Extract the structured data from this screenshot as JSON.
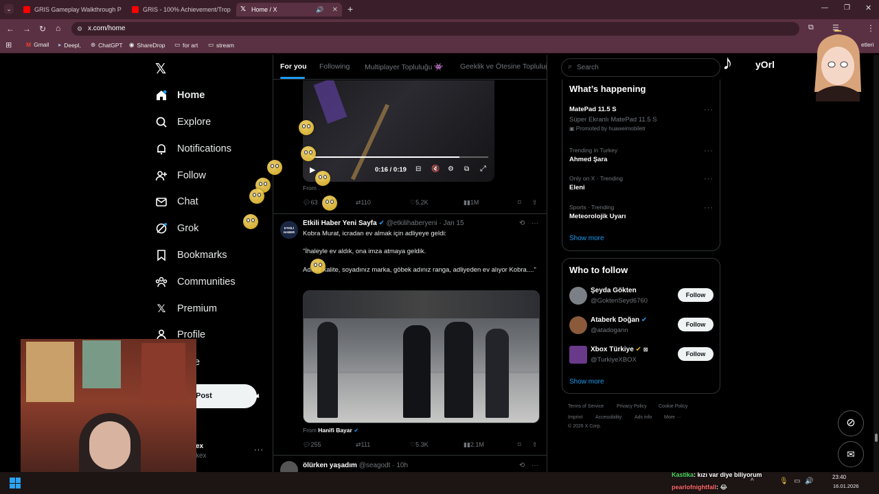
{
  "browser": {
    "tabs": [
      {
        "label": "GRIS Gameplay Walkthrough P"
      },
      {
        "label": "GRIS - 100% Achievement/Trop"
      },
      {
        "label": "Home / X"
      }
    ],
    "url": "x.com/home",
    "bookmarks": [
      "Gmail",
      "Deepl,",
      "ChatGPT",
      "ShareDrop",
      "for art",
      "stream"
    ],
    "bookmarks_overflow": "etleri"
  },
  "nav": {
    "items": [
      {
        "label": "Home",
        "icon": "home-icon"
      },
      {
        "label": "Explore",
        "icon": "search-icon"
      },
      {
        "label": "Notifications",
        "icon": "bell-icon"
      },
      {
        "label": "Follow",
        "icon": "person-add-icon"
      },
      {
        "label": "Chat",
        "icon": "mail-icon"
      },
      {
        "label": "Grok",
        "icon": "grok-icon"
      },
      {
        "label": "Bookmarks",
        "icon": "bookmark-icon"
      },
      {
        "label": "Communities",
        "icon": "communities-icon"
      },
      {
        "label": "Premium",
        "icon": "x-logo-icon"
      },
      {
        "label": "Profile",
        "icon": "person-icon"
      }
    ],
    "more_partial": "e",
    "post_label": "Post",
    "account_name_partial": "ex",
    "account_handle_partial": "kex"
  },
  "feed": {
    "tabs": [
      "For you",
      "Following",
      "Multiplayer Topluluğu 👾",
      "Geeklik ve Ötesine Topluluğ"
    ],
    "video": {
      "time": "0:16 / 0:19",
      "progress": 0.84
    },
    "video_tweet": {
      "from": "From .",
      "replies": "63",
      "reposts": "110",
      "likes": "5.2K",
      "views": "1M"
    },
    "tweet2": {
      "avatar_text": "ETKİLİ HABER",
      "name": "Etkili Haber Yeni Sayfa",
      "handle": "@etkilihaberyeni",
      "date": "· Jan 15",
      "line1": "Kobra Murat, icradan ev almak için adliyeye geldi:",
      "line2": "\"İhaleyle ev aldık, ona imza atmaya geldik.",
      "line3": "Adınız kalite, soyadınız marka, göbek adınız ranga, adliyeden ev alıyor Kobra....\"",
      "from_prefix": "From",
      "from_name": "Hanifi Bayar",
      "replies": "255",
      "reposts": "111",
      "likes": "5.3K",
      "views": "2.1M"
    },
    "tweet3": {
      "name": "ölürken yaşadım",
      "handle": "@seagodt",
      "date": "· 10h"
    }
  },
  "right": {
    "search_placeholder": "Search",
    "whats_happening_title": "What’s happening",
    "trends": [
      {
        "context": "",
        "title": "MatePad 11.5 S",
        "sub": "Süper Ekranlı MatePad 11.5 S",
        "promo": "Promoted by huaweimobiletr"
      },
      {
        "context": "Trending in Turkey",
        "title": "Ahmed Şara"
      },
      {
        "context": "Only on X · Trending",
        "title": "Eleni"
      },
      {
        "context": "Sports · Trending",
        "title": "Meteorolojik Uyarı"
      }
    ],
    "show_more": "Show more",
    "who_to_follow_title": "Who to follow",
    "who": [
      {
        "name": "Şeyda Gökten",
        "handle": "@GoktenSeyd6760"
      },
      {
        "name": "Ataberk Doğan",
        "handle": "@atadogann"
      },
      {
        "name": "Xbox Türkiye",
        "handle": "@TurkiyeXBOX"
      }
    ],
    "follow_label": "Follow",
    "footer": [
      "Terms of Service",
      "Privacy Policy",
      "Cookie Policy",
      "Imprint",
      "Accessibility",
      "Ads info",
      "More ···",
      "© 2026 X Corp."
    ]
  },
  "overlay": {
    "tiktok_name": "yOrl",
    "chat": [
      {
        "user": "Kastika",
        "text": ": kızı var diye biliyorum",
        "color": "#4cd964"
      },
      {
        "user": "pearlofnightfall",
        "text": ": 😂",
        "color": "#ff6b6b"
      }
    ]
  },
  "taskbar": {
    "time": "23:40",
    "date": "16.01.2026"
  },
  "colors": {
    "accent": "#1d9bf0",
    "browser_frame": "#5a3142",
    "background": "#000000"
  }
}
